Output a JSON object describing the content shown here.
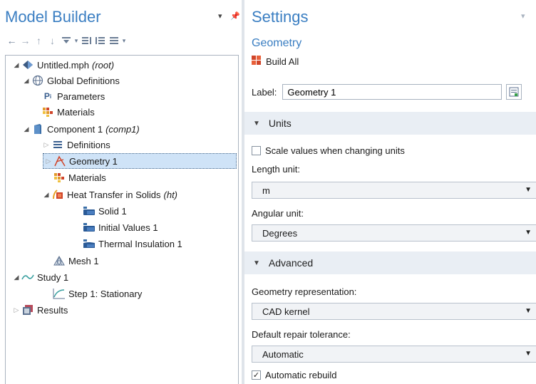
{
  "model_builder": {
    "title": "Model Builder",
    "tree": [
      {
        "id": "root",
        "label": "Untitled.mph",
        "tag": "(root)"
      },
      {
        "id": "global-definitions",
        "label": "Global Definitions"
      },
      {
        "id": "parameters",
        "label": "Parameters"
      },
      {
        "id": "global-materials",
        "label": "Materials"
      },
      {
        "id": "component",
        "label": "Component 1",
        "tag": "(comp1)"
      },
      {
        "id": "definitions",
        "label": "Definitions"
      },
      {
        "id": "geometry",
        "label": "Geometry 1"
      },
      {
        "id": "materials",
        "label": "Materials"
      },
      {
        "id": "heat-transfer",
        "label": "Heat Transfer in Solids",
        "tag": "(ht)"
      },
      {
        "id": "solid",
        "label": "Solid 1"
      },
      {
        "id": "initial-values",
        "label": "Initial Values 1"
      },
      {
        "id": "thermal-insulation",
        "label": "Thermal Insulation 1"
      },
      {
        "id": "mesh",
        "label": "Mesh 1"
      },
      {
        "id": "study",
        "label": "Study 1"
      },
      {
        "id": "step",
        "label": "Step 1: Stationary"
      },
      {
        "id": "results",
        "label": "Results"
      }
    ]
  },
  "settings": {
    "title": "Settings",
    "subtitle": "Geometry",
    "build_all": "Build All",
    "label_caption": "Label:",
    "label_value": "Geometry 1",
    "units": {
      "section": "Units",
      "scale_values": "Scale values when changing units",
      "scale_values_checked": false,
      "length_unit_label": "Length unit:",
      "length_unit": "m",
      "angular_unit_label": "Angular unit:",
      "angular_unit": "Degrees"
    },
    "advanced": {
      "section": "Advanced",
      "geometry_representation_label": "Geometry representation:",
      "geometry_representation": "CAD kernel",
      "repair_tolerance_label": "Default repair tolerance:",
      "repair_tolerance": "Automatic",
      "automatic_rebuild": "Automatic rebuild",
      "automatic_rebuild_checked": true
    }
  },
  "colors": {
    "accent": "#3a7ec2",
    "selection": "#cfe3f7",
    "section_bg": "#e9eef4"
  }
}
